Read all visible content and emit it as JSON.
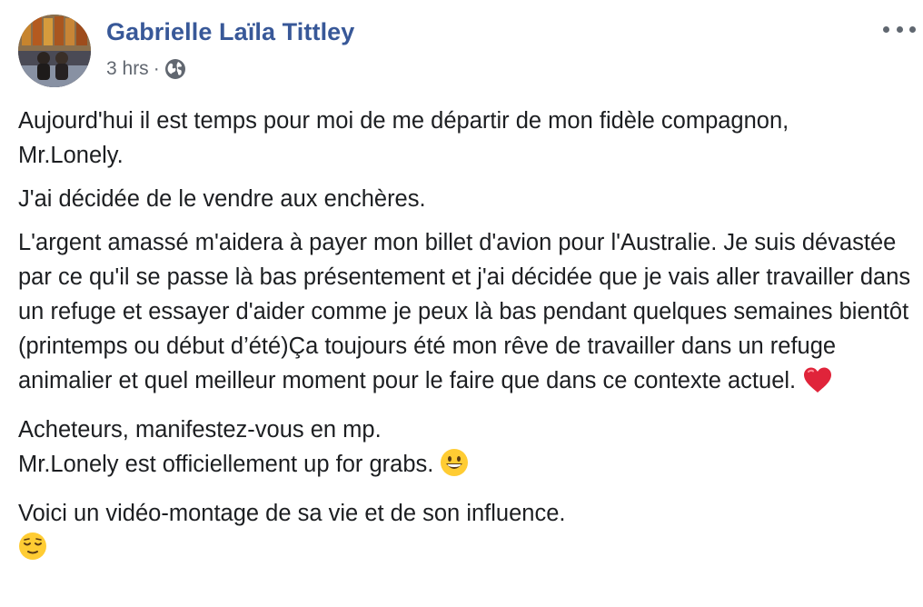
{
  "post": {
    "author": "Gabrielle Laïla Tittley",
    "timestamp": "3 hrs",
    "separator": "·",
    "privacy_icon": "globe-icon",
    "more_icon": "more-options-icon",
    "paragraphs": [
      "Aujourd'hui il est temps pour moi de me départir de mon fidèle compagnon,\nMr.Lonely.",
      "J'ai décidée de le vendre aux enchères.",
      "L'argent amassé m'aidera à payer mon billet d'avion pour l'Australie. Je suis dévastée par ce qu'il se passe là bas présentement et j'ai décidée que je vais aller travailler dans un refuge et essayer d'aider comme je peux là bas pendant quelques semaines bientôt (printemps ou début d’été)Ça toujours été mon rêve de travailler dans un refuge animalier et quel meilleur moment pour le faire que dans ce contexte actuel.",
      "Acheteurs, manifestez-vous en mp.\nMr.Lonely est officiellement up for grabs.",
      "Voici un vidéo-montage de sa vie et de son influence."
    ],
    "emojis": [
      "heart-emoji",
      "grinning-face-emoji",
      "relieved-face-emoji"
    ]
  },
  "colors": {
    "author_link": "#385898",
    "text": "#1c1e21",
    "meta": "#616770"
  }
}
